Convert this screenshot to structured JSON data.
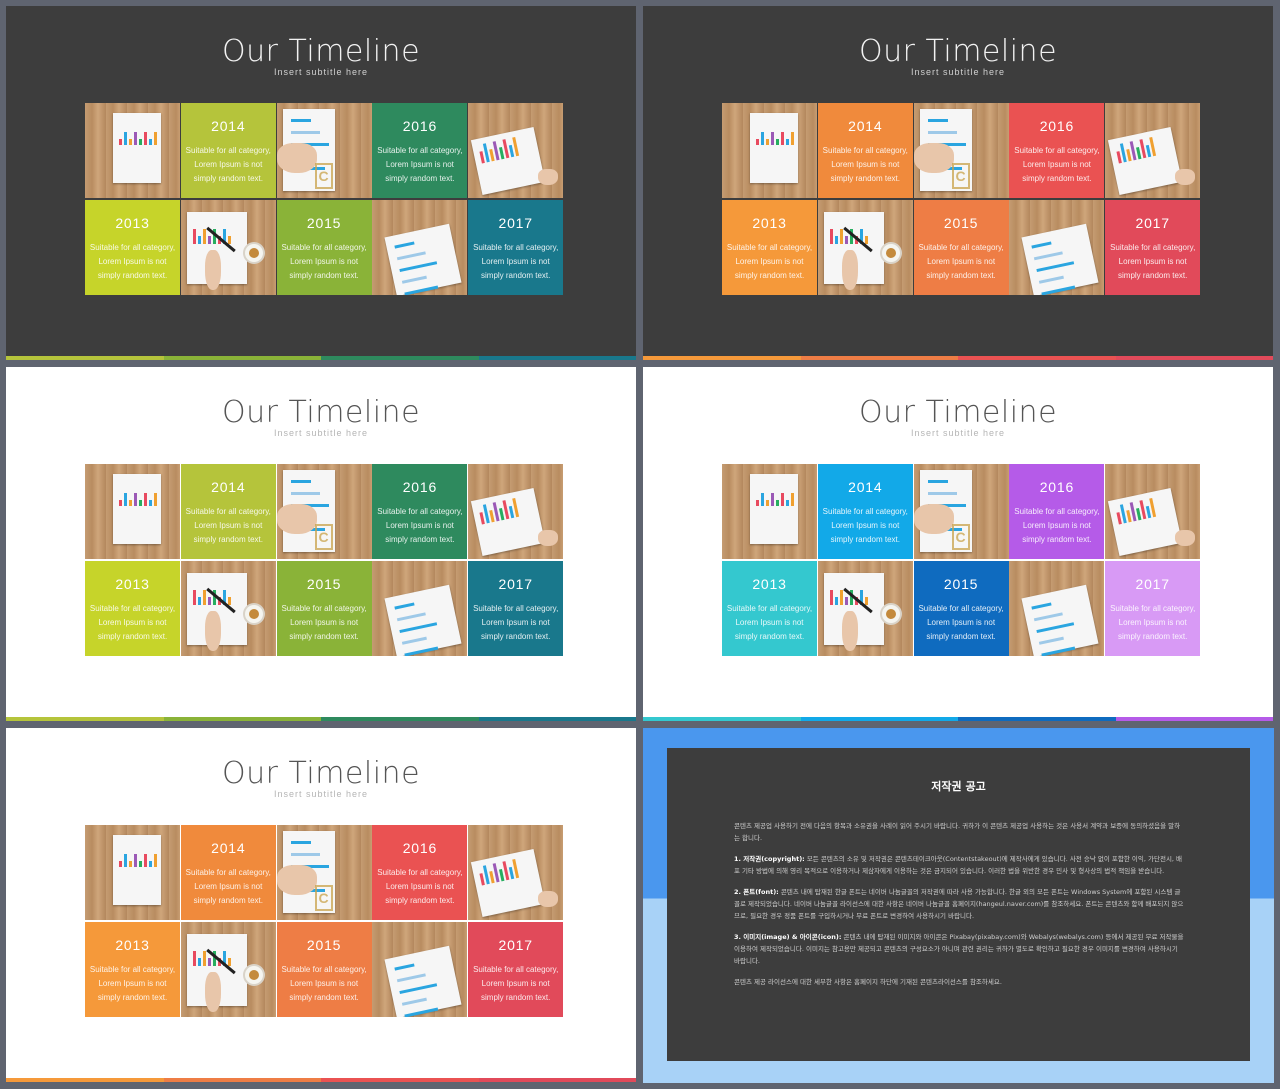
{
  "slides": [
    {
      "id": "slide-1",
      "theme": "dark",
      "title": "Our Timeline",
      "subtitle": "Insert  subtitle  here",
      "colors": {
        "2014": "#b5c43b",
        "2016": "#2e8a5e",
        "2013": "#c6d42a",
        "2015": "#8ab338",
        "2017": "#19788c"
      },
      "strip": [
        "#b5c43b",
        "#8ab338",
        "#2e8a5e",
        "#19788c"
      ]
    },
    {
      "id": "slide-2",
      "theme": "dark",
      "title": "Our Timeline",
      "subtitle": "Insert  subtitle  here",
      "colors": {
        "2014": "#f08a3c",
        "2016": "#ea5252",
        "2013": "#f5993a",
        "2015": "#ee7d45",
        "2017": "#e14a5a"
      },
      "strip": [
        "#f5993a",
        "#ee7d45",
        "#ea5252",
        "#e14a5a"
      ]
    },
    {
      "id": "slide-3",
      "theme": "light",
      "title": "Our Timeline",
      "subtitle": "Insert  subtitle  here",
      "colors": {
        "2014": "#b5c43b",
        "2016": "#2e8a5e",
        "2013": "#c6d42a",
        "2015": "#8ab338",
        "2017": "#19788c"
      },
      "strip": [
        "#b5c43b",
        "#8ab338",
        "#2e8a5e",
        "#19788c"
      ]
    },
    {
      "id": "slide-4",
      "theme": "light",
      "title": "Our Timeline",
      "subtitle": "Insert  subtitle  here",
      "colors": {
        "2014": "#12a9e8",
        "2016": "#b55be8",
        "2013": "#34c8cf",
        "2015": "#0f6bbf",
        "2017": "#d89af5"
      },
      "strip": [
        "#34c8cf",
        "#12a9e8",
        "#0f6bbf",
        "#b55be8"
      ]
    },
    {
      "id": "slide-5",
      "theme": "light",
      "title": "Our Timeline",
      "subtitle": "Insert  subtitle  here",
      "colors": {
        "2014": "#f08a3c",
        "2016": "#ea5252",
        "2013": "#f5993a",
        "2015": "#ee7d45",
        "2017": "#e14a5a"
      },
      "strip": [
        "#f5993a",
        "#ee7d45",
        "#ea5252",
        "#e14a5a"
      ]
    }
  ],
  "timeline": {
    "years": {
      "y2014": "2014",
      "y2016": "2016",
      "y2013": "2013",
      "y2015": "2015",
      "y2017": "2017"
    },
    "body": "Suitable for all category, Lorem Ipsum is not simply random text."
  },
  "notice": {
    "title": "저작권 공고",
    "intro": "콘텐츠 제공업 사용하기 전에 다음의 항목과 소유권을 사례이 읽어 주시기 바랍니다. 귀하가 이 콘텐츠 제공업 사용하는 것은 사용서 계약과 보증에 동의하셨음을 말하는 합니다.",
    "p1_label": "1. 저작권(copyright):",
    "p1": " 모든 콘텐츠의 소유 및 저작권은 콘텐츠테이크아웃(Contentstakeout)에 제작사에게 있습니다. 사전 승낙 없이 포함한 이익, 가단전시, 배포 기타 방법에 의해 영리 목적으로 이용하거나 제삼자에게 이용하는 것은 금지되어 있습니다. 이러한 법을 위반한 경우 민사 및 형사상의 법적 책임을 받습니다.",
    "p2_label": "2. 폰트(font):",
    "p2": " 콘텐츠 내에 탑재된 한글 폰트는 네이버 나눔글꼴의 저작권에 따라 사용 가능합니다. 한글 외의 모든 폰트는 Windows System에 포함된 시스템 글꼴로 제작되었습니다. 네이버 나눔글꼴 라이선스에 대한 사항은 네이버 나눔글꼴 홈페이지(hangeul.naver.com)를 참조하세요. 폰트는 콘텐츠와 함께 배포되지 않으므로, 필요한 경우 정품 폰트를 구입하시거나 무료 폰트로 변경하여 사용하시기 바랍니다.",
    "p3_label": "3. 이미지(image) & 아이콘(icon):",
    "p3": " 콘텐츠 내에 탑재된 이미지와 아이콘은 Pixabay(pixabay.com)와 Webalys(webalys.com) 등에서 제공된 무료 저작물을 이용하여 제작되었습니다. 이미지는 참고용만 제공되고 콘텐츠의 구성요소가 아니며 관련 권리는 귀하가 별도로 확인하고 필요한 경우 이미지를 변경하여 사용하시기 바랍니다.",
    "outro": "콘텐츠 제공 라이선스에 대한 세부한 사항은 홈페이지 하단에 기재된 콘텐츠라이선스를 참조하세요."
  }
}
